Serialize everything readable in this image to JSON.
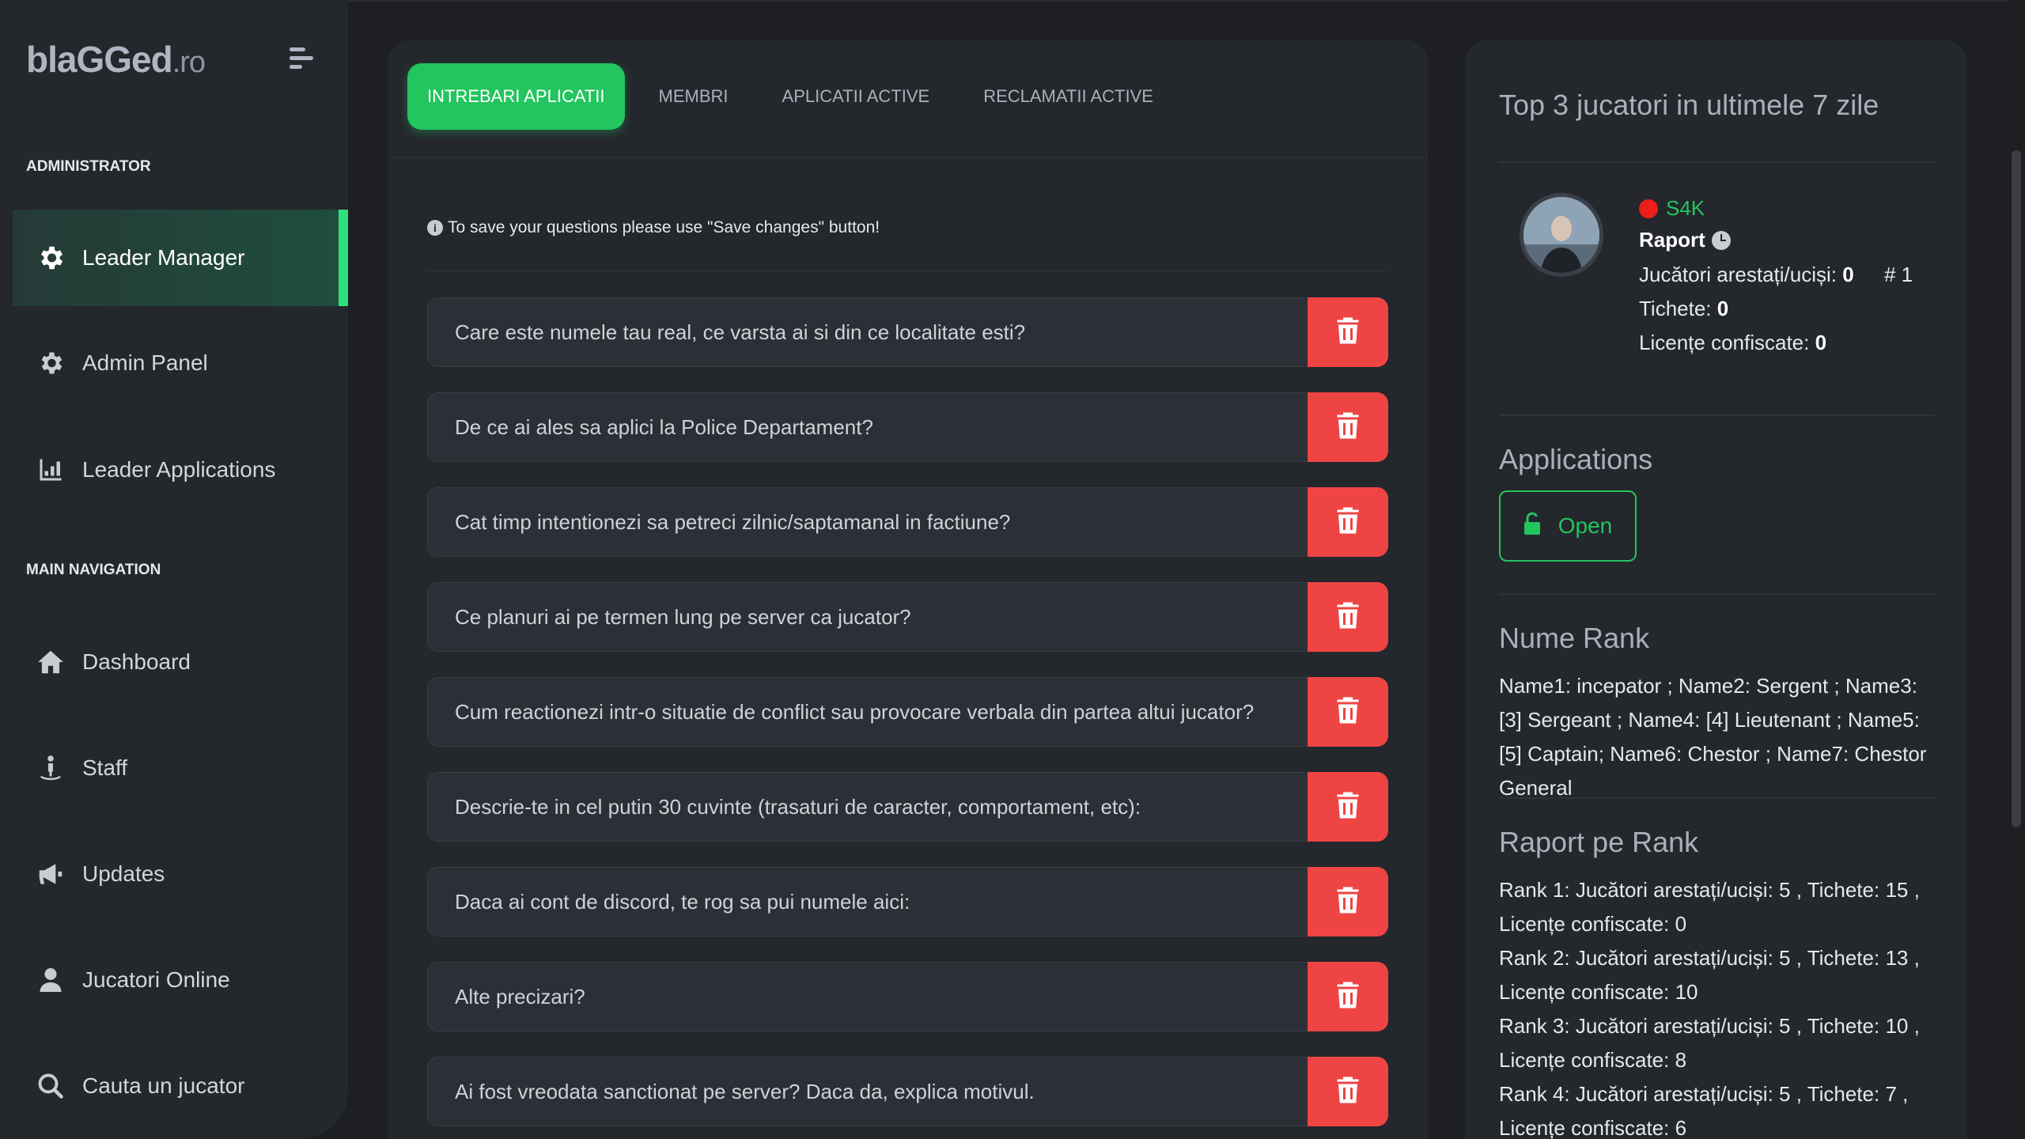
{
  "logo": {
    "name": "blaGGed",
    "tld": ".ro"
  },
  "sidebar": {
    "section_admin": "ADMINISTRATOR",
    "admin_items": [
      {
        "label": "Leader Manager",
        "icon": "gear-icon",
        "active": true
      },
      {
        "label": "Admin Panel",
        "icon": "gear-icon",
        "active": false
      },
      {
        "label": "Leader Applications",
        "icon": "chart-icon",
        "active": false
      }
    ],
    "section_main": "MAIN NAVIGATION",
    "main_items": [
      {
        "label": "Dashboard",
        "icon": "home-icon"
      },
      {
        "label": "Staff",
        "icon": "staff-icon"
      },
      {
        "label": "Updates",
        "icon": "megaphone-icon"
      },
      {
        "label": "Jucatori Online",
        "icon": "user-icon"
      },
      {
        "label": "Cauta un jucator",
        "icon": "search-icon"
      }
    ]
  },
  "tabs": [
    {
      "label": "INTREBARI APLICATII",
      "active": true
    },
    {
      "label": "MEMBRI",
      "active": false
    },
    {
      "label": "APLICATII ACTIVE",
      "active": false
    },
    {
      "label": "RECLAMATII ACTIVE",
      "active": false
    }
  ],
  "info_text": "To save your questions please use \"Save changes\" button!",
  "questions": [
    "Care este numele tau real, ce varsta ai si din ce localitate esti?",
    "De ce ai ales sa aplici la Police Departament?",
    "Cat timp intentionezi sa petreci zilnic/saptamanal in factiune?",
    "Ce planuri ai pe termen lung pe server ca jucator?",
    "Cum reactionezi intr-o situatie de conflict sau provocare verbala din partea altui jucator?",
    "Descrie-te in cel putin 30 cuvinte (trasaturi de caracter, comportament, etc):",
    "Daca ai cont de discord, te rog sa pui numele aici:",
    "Alte precizari?",
    "Ai fost vreodata sanctionat pe server? Daca da, explica motivul."
  ],
  "right": {
    "top_title": "Top 3 jucatori in ultimele 7 zile",
    "player": {
      "name": "S4K",
      "report_label": "Raport",
      "arrested_label": "Jucători arestați/uciși:",
      "arrested_value": "0",
      "tickets_label": "Tichete:",
      "tickets_value": "0",
      "licenses_label": "Licențe confiscate:",
      "licenses_value": "0",
      "rank": "# 1"
    },
    "applications_title": "Applications",
    "open_label": "Open",
    "rank_names_title": "Nume Rank",
    "rank_names_text": "Name1: incepator ; Name2: Sergent ; Name3: [3] Sergeant ; Name4: [4] Lieutenant ; Name5: [5] Captain; Name6: Chestor ; Name7: Chestor General",
    "rank_report_title": "Raport pe Rank",
    "rank_report": [
      "Rank 1: Jucători arestați/uciși: 5 , Tichete: 15 , Licențe confiscate: 0",
      "Rank 2: Jucători arestați/uciși: 5 , Tichete: 13 , Licențe confiscate: 10",
      "Rank 3: Jucători arestați/uciși: 5 , Tichete: 10 , Licențe confiscate: 8",
      "Rank 4: Jucători arestați/uciși: 5 , Tichete: 7 , Licențe confiscate: 6"
    ]
  },
  "colors": {
    "accent": "#22c55e",
    "danger": "#ef4444",
    "background": "#1d1f23",
    "card": "#24272c"
  }
}
